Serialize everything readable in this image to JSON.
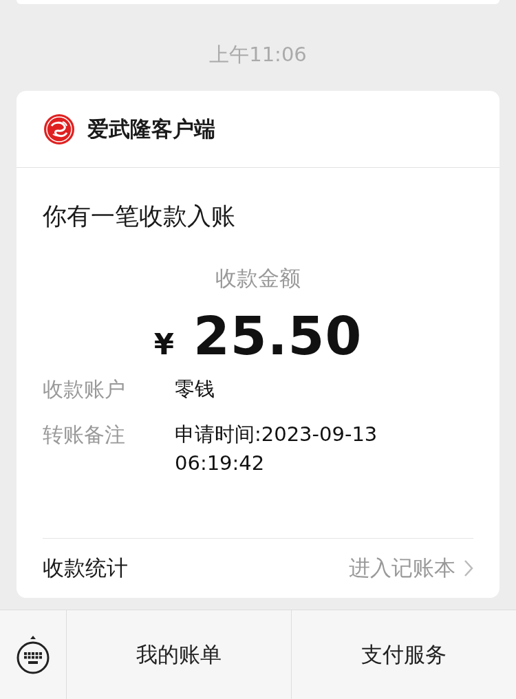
{
  "timestamp": "上午11:06",
  "card": {
    "app_name": "爱武隆客户端",
    "title": "你有一笔收款入账",
    "amount_label": "收款金额",
    "currency": "¥",
    "amount": "25.50",
    "details": [
      {
        "label": "收款账户",
        "value": "零钱"
      },
      {
        "label": "转账备注",
        "value": "申请时间:2023-09-13 06:19:42"
      }
    ],
    "footer": {
      "label": "收款统计",
      "link": "进入记账本"
    }
  },
  "menu": [
    "我的账单",
    "支付服务"
  ]
}
